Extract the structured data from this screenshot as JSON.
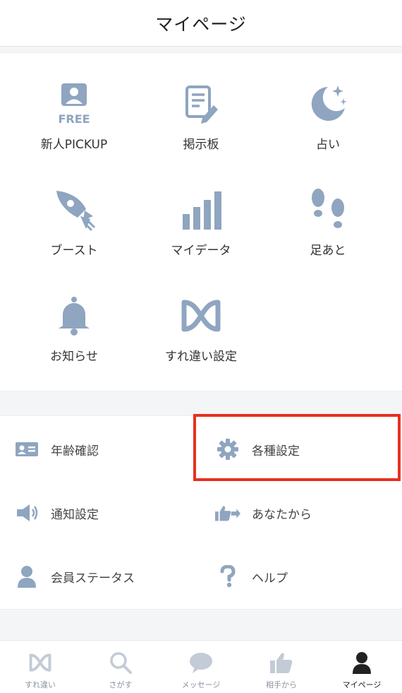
{
  "header": {
    "title": "マイページ"
  },
  "grid": {
    "items": [
      {
        "label": "新人PICKUP",
        "icon": "new-member-free-icon"
      },
      {
        "label": "掲示板",
        "icon": "bulletin-board-icon"
      },
      {
        "label": "占い",
        "icon": "moon-stars-icon"
      },
      {
        "label": "ブースト",
        "icon": "rocket-icon"
      },
      {
        "label": "マイデータ",
        "icon": "bar-chart-icon"
      },
      {
        "label": "足あと",
        "icon": "footprints-icon"
      },
      {
        "label": "お知らせ",
        "icon": "bell-icon"
      },
      {
        "label": "すれ違い設定",
        "icon": "surechigai-logo-icon"
      }
    ],
    "free_badge": "FREE"
  },
  "list": {
    "items": [
      {
        "label": "年齢確認",
        "icon": "id-card-icon"
      },
      {
        "label": "各種設定",
        "icon": "gear-icon"
      },
      {
        "label": "通知設定",
        "icon": "speaker-icon"
      },
      {
        "label": "あなたから",
        "icon": "thumbs-up-arrow-icon"
      },
      {
        "label": "会員ステータス",
        "icon": "user-icon"
      },
      {
        "label": "ヘルプ",
        "icon": "question-icon"
      }
    ]
  },
  "tabs": [
    {
      "label": "すれ違い",
      "icon": "surechigai-logo-icon"
    },
    {
      "label": "さがす",
      "icon": "search-icon"
    },
    {
      "label": "メッセージ",
      "icon": "chat-bubble-icon"
    },
    {
      "label": "相手から",
      "icon": "thumbs-up-icon"
    },
    {
      "label": "マイページ",
      "icon": "user-icon",
      "active": true
    }
  ],
  "colors": {
    "icon": "#9aaec6",
    "icon_dark": "#7f93ad",
    "tab_inactive": "#c3cbd6",
    "tab_active": "#222222",
    "highlight": "#e8301f"
  }
}
